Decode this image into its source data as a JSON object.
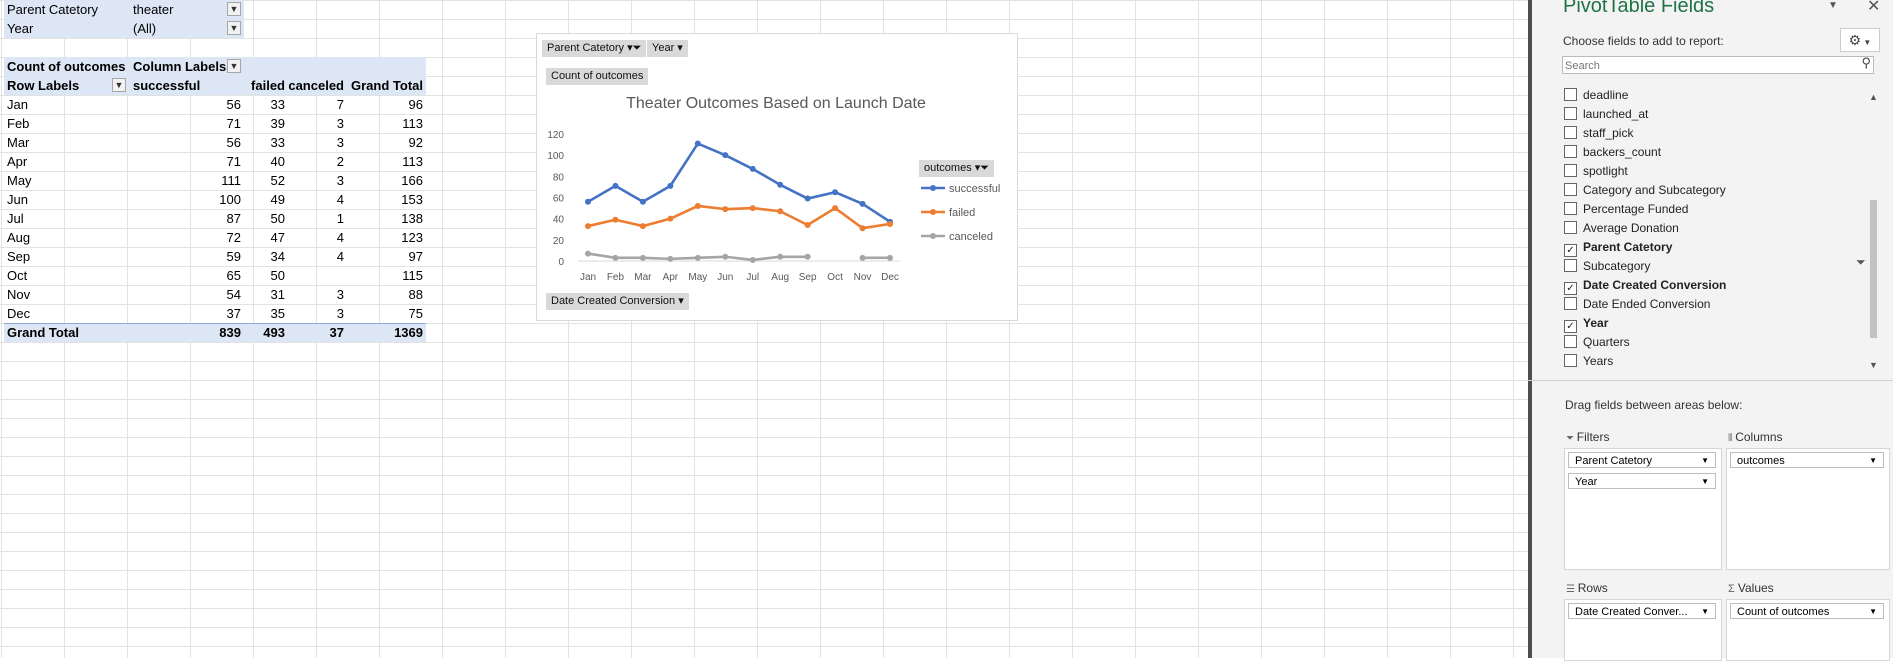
{
  "pivot": {
    "filters": [
      {
        "label": "Parent Catetory",
        "value": "theater"
      },
      {
        "label": "Year",
        "value": "(All)"
      }
    ],
    "header": {
      "measure": "Count of outcomes",
      "column_labels": "Column Labels",
      "row_labels": "Row Labels",
      "columns": [
        "successful",
        "failed",
        "canceled",
        "Grand Total"
      ]
    },
    "rows": [
      {
        "label": "Jan",
        "successful": "56",
        "failed": "33",
        "canceled": "7",
        "total": "96"
      },
      {
        "label": "Feb",
        "successful": "71",
        "failed": "39",
        "canceled": "3",
        "total": "113"
      },
      {
        "label": "Mar",
        "successful": "56",
        "failed": "33",
        "canceled": "3",
        "total": "92"
      },
      {
        "label": "Apr",
        "successful": "71",
        "failed": "40",
        "canceled": "2",
        "total": "113"
      },
      {
        "label": "May",
        "successful": "111",
        "failed": "52",
        "canceled": "3",
        "total": "166"
      },
      {
        "label": "Jun",
        "successful": "100",
        "failed": "49",
        "canceled": "4",
        "total": "153"
      },
      {
        "label": "Jul",
        "successful": "87",
        "failed": "50",
        "canceled": "1",
        "total": "138"
      },
      {
        "label": "Aug",
        "successful": "72",
        "failed": "47",
        "canceled": "4",
        "total": "123"
      },
      {
        "label": "Sep",
        "successful": "59",
        "failed": "34",
        "canceled": "4",
        "total": "97"
      },
      {
        "label": "Oct",
        "successful": "65",
        "failed": "50",
        "canceled": "",
        "total": "115"
      },
      {
        "label": "Nov",
        "successful": "54",
        "failed": "31",
        "canceled": "3",
        "total": "88"
      },
      {
        "label": "Dec",
        "successful": "37",
        "failed": "35",
        "canceled": "3",
        "total": "75"
      }
    ],
    "grand_total": {
      "label": "Grand Total",
      "successful": "839",
      "failed": "493",
      "canceled": "37",
      "total": "1369"
    }
  },
  "chart": {
    "filter_buttons": [
      "Parent Catetory",
      "Year"
    ],
    "value_button": "Count of outcomes",
    "axis_button": "Date Created Conversion",
    "legend_button": "outcomes",
    "colors": {
      "successful": "#4472c4",
      "failed": "#ed7d31",
      "canceled": "#a5a5a5"
    }
  },
  "chart_data": {
    "type": "line",
    "title": "Theater Outcomes Based on Launch Date",
    "categories": [
      "Jan",
      "Feb",
      "Mar",
      "Apr",
      "May",
      "Jun",
      "Jul",
      "Aug",
      "Sep",
      "Oct",
      "Nov",
      "Dec"
    ],
    "series": [
      {
        "name": "successful",
        "values": [
          56,
          71,
          56,
          71,
          111,
          100,
          87,
          72,
          59,
          65,
          54,
          37
        ]
      },
      {
        "name": "failed",
        "values": [
          33,
          39,
          33,
          40,
          52,
          49,
          50,
          47,
          34,
          50,
          31,
          35
        ]
      },
      {
        "name": "canceled",
        "values": [
          7,
          3,
          3,
          2,
          3,
          4,
          1,
          4,
          4,
          null,
          3,
          3
        ]
      }
    ],
    "yticks": [
      "0",
      "20",
      "40",
      "60",
      "80",
      "100",
      "120"
    ],
    "ylim": [
      0,
      120
    ],
    "legend": "right",
    "grid": false
  },
  "pane": {
    "title": "PivotTable Fields",
    "choose_text": "Choose fields to add to report:",
    "search_placeholder": "Search",
    "fields": [
      {
        "name": "deadline",
        "checked": false
      },
      {
        "name": "launched_at",
        "checked": false
      },
      {
        "name": "staff_pick",
        "checked": false
      },
      {
        "name": "backers_count",
        "checked": false
      },
      {
        "name": "spotlight",
        "checked": false
      },
      {
        "name": "Category and Subcategory",
        "checked": false
      },
      {
        "name": "Percentage Funded",
        "checked": false
      },
      {
        "name": "Average Donation",
        "checked": false
      },
      {
        "name": "Parent Catetory",
        "checked": true
      },
      {
        "name": "Subcategory",
        "checked": false
      },
      {
        "name": "Date Created Conversion",
        "checked": true
      },
      {
        "name": "Date Ended Conversion",
        "checked": false
      },
      {
        "name": "Year",
        "checked": true
      },
      {
        "name": "Quarters",
        "checked": false
      },
      {
        "name": "Years",
        "checked": false
      }
    ],
    "drag_text": "Drag fields between areas below:",
    "areas": {
      "filters_label": "Filters",
      "columns_label": "Columns",
      "rows_label": "Rows",
      "values_label": "Values",
      "filters": [
        "Parent Catetory",
        "Year"
      ],
      "columns": [
        "outcomes"
      ],
      "rows": [
        "Date Created Conver..."
      ],
      "values": [
        "Count of outcomes"
      ]
    }
  }
}
